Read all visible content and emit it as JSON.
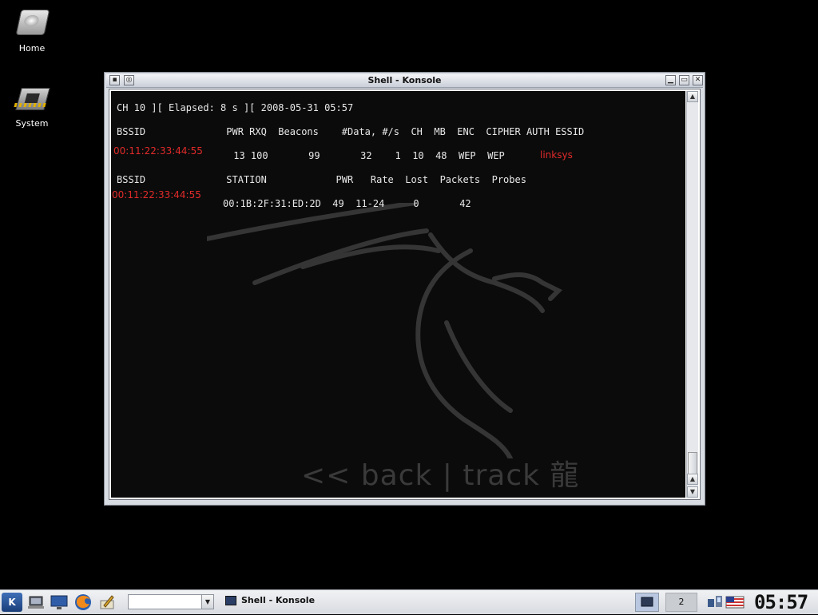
{
  "desktop": {
    "icons": [
      {
        "label": "Home",
        "icon": "hard-drive-icon"
      },
      {
        "label": "System",
        "icon": "chip-icon"
      }
    ]
  },
  "window": {
    "title": "Shell - Konsole",
    "buttons": [
      "menu",
      "sticky",
      "minimize",
      "maximize",
      "close"
    ]
  },
  "terminal": {
    "status_line": "CH 10 ][ Elapsed: 8 s ][ 2008-05-31 05:57",
    "ap_header": "BSSID              PWR RXQ  Beacons    #Data, #/s  CH  MB  ENC  CIPHER AUTH ESSID",
    "ap_bssid": "00:11:22:33:44:55",
    "ap_values": " 13 100       99       32    1  10  48  WEP  WEP",
    "ap_essid": "linksys",
    "sta_header": "BSSID              STATION            PWR   Rate  Lost  Packets  Probes",
    "sta_bssid": "00:11:22:33:44:55",
    "sta_values": "00:1B:2F:31:ED:2D  49  11-24     0       42",
    "watermark": "<< back | track 龍"
  },
  "taskbar": {
    "kmenu": "K",
    "quick_launch": [
      "desktop-icon",
      "monitor-icon",
      "firefox-icon",
      "editor-icon"
    ],
    "combo_value": "",
    "task_label": "Shell - Konsole",
    "desktop_number": "2",
    "clock": "05:57",
    "colors": {
      "accent": "#2b5aa0",
      "error": "#e12a2a"
    }
  }
}
